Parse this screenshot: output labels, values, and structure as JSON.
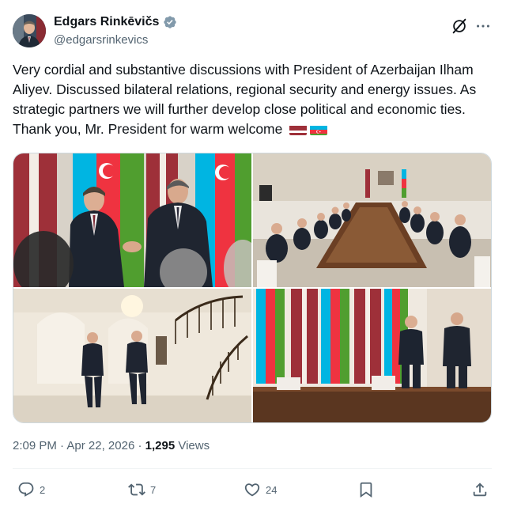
{
  "author": {
    "display_name": "Edgars Rinkēvičs",
    "handle": "@edgarsrinkevics",
    "verified": true
  },
  "post": {
    "text": "Very cordial and substantive discussions with President of Azerbaijan Ilham Aliyev. Discussed bilateral relations, regional security and energy issues. As strategic partners we will further develop close political and economic ties. Thank you, Mr. President for warm welcome",
    "emoji_flags": [
      "latvia-flag",
      "azerbaijan-flag"
    ]
  },
  "media": {
    "photos": [
      "handshake-photo",
      "delegation-meeting-photo",
      "walking-hall-photo",
      "flags-posing-photo"
    ]
  },
  "meta": {
    "time": "2:09 PM",
    "separator": " · ",
    "date": "Apr 22, 2026",
    "separator2": " · ",
    "views_count": "1,295",
    "views_label": " Views"
  },
  "actions": {
    "replies": "2",
    "reposts": "7",
    "likes": "24"
  },
  "colors": {
    "text": "#0f1419",
    "secondary": "#536471",
    "verified_badge": "#829aab",
    "latvia_red": "#9e3039",
    "azerbaijan_blue": "#00b5e2",
    "azerbaijan_red": "#ef3340",
    "azerbaijan_green": "#509e2f"
  }
}
